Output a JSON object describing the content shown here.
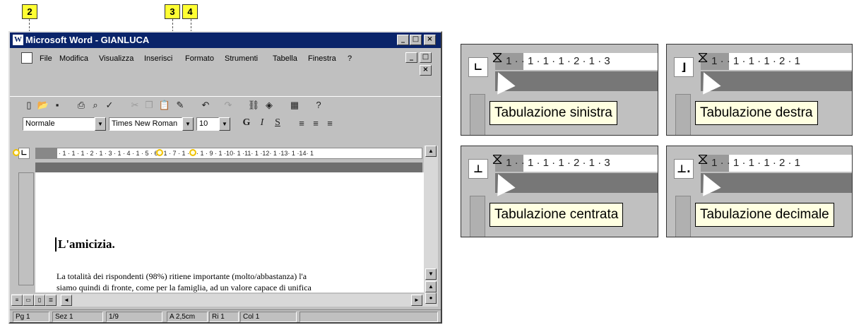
{
  "callouts": [
    "2",
    "3",
    "4"
  ],
  "window": {
    "title": "Microsoft Word - GIANLUCA",
    "app_icon": "W",
    "controls": {
      "minimize": "_",
      "restore": "□",
      "close": "×"
    }
  },
  "menu": [
    {
      "label": "File"
    },
    {
      "label": "Modifica"
    },
    {
      "label": "Visualizza"
    },
    {
      "label": "Inserisci"
    },
    {
      "label": "Formato"
    },
    {
      "label": "Strumenti"
    },
    {
      "label": "Tabella"
    },
    {
      "label": "Finestra"
    },
    {
      "label": "?"
    }
  ],
  "toolbar_icons": [
    "new-icon",
    "open-icon",
    "save-icon",
    "print-icon",
    "print-preview-icon",
    "spelling-icon",
    "cut-icon",
    "copy-icon",
    "paste-icon",
    "format-painter-icon",
    "undo-icon",
    "redo-icon",
    "hyperlink-icon",
    "web-icon",
    "table-icon",
    "help-icon"
  ],
  "format": {
    "style": "Normale",
    "font": "Times New Roman",
    "size": "10",
    "bold": "G",
    "italic": "I",
    "underline": "S"
  },
  "ruler": {
    "text": "· 1 · 1 · 1 · 2 · 1 · 3 · 1 · 4 · 1 · 5 · 6 · 1 · 7 · 1 · 8 · 1 · 9 · 1 ·10· 1 ·11· 1 ·12· 1 ·13· 1 ·14· 1",
    "tab_selector": "∟"
  },
  "document": {
    "heading": "L'amicizia.",
    "body_line1": "La totalità dei rispondenti (98%) ritiene importante (molto/abbastanza) l'a",
    "body_line2": "siamo quindi di fronte, come per la famiglia, ad un valore capace di unifica"
  },
  "status": {
    "page": "Pg 1",
    "section": "Sez 1",
    "pages": "1/9",
    "at": "A 2,5cm",
    "line": "Ri 1",
    "col": "Col 1"
  },
  "panels": [
    {
      "symbol": "∟",
      "tooltip": "Tabulazione sinistra",
      "ruler": "· 1 ·  · 1 · 1 · 1 · 2 · 1 · 3"
    },
    {
      "symbol": "⌋",
      "tooltip": "Tabulazione destra",
      "ruler": "· 1 ·  · 1 · 1 · 1 · 2 · 1"
    },
    {
      "symbol": "⊥",
      "tooltip": "Tabulazione centrata",
      "ruler": "· 1 ·  · 1 · 1 · 1 · 2 · 1 · 3"
    },
    {
      "symbol": "⊥.",
      "tooltip": "Tabulazione decimale",
      "ruler": "· 1 ·  · 1 · 1 · 1 · 2 · 1"
    }
  ],
  "colors": {
    "titlebar": "#0a246a",
    "callout": "#ffff33",
    "tooltip": "#ffffe1",
    "tab_marker": "#f0c000"
  }
}
